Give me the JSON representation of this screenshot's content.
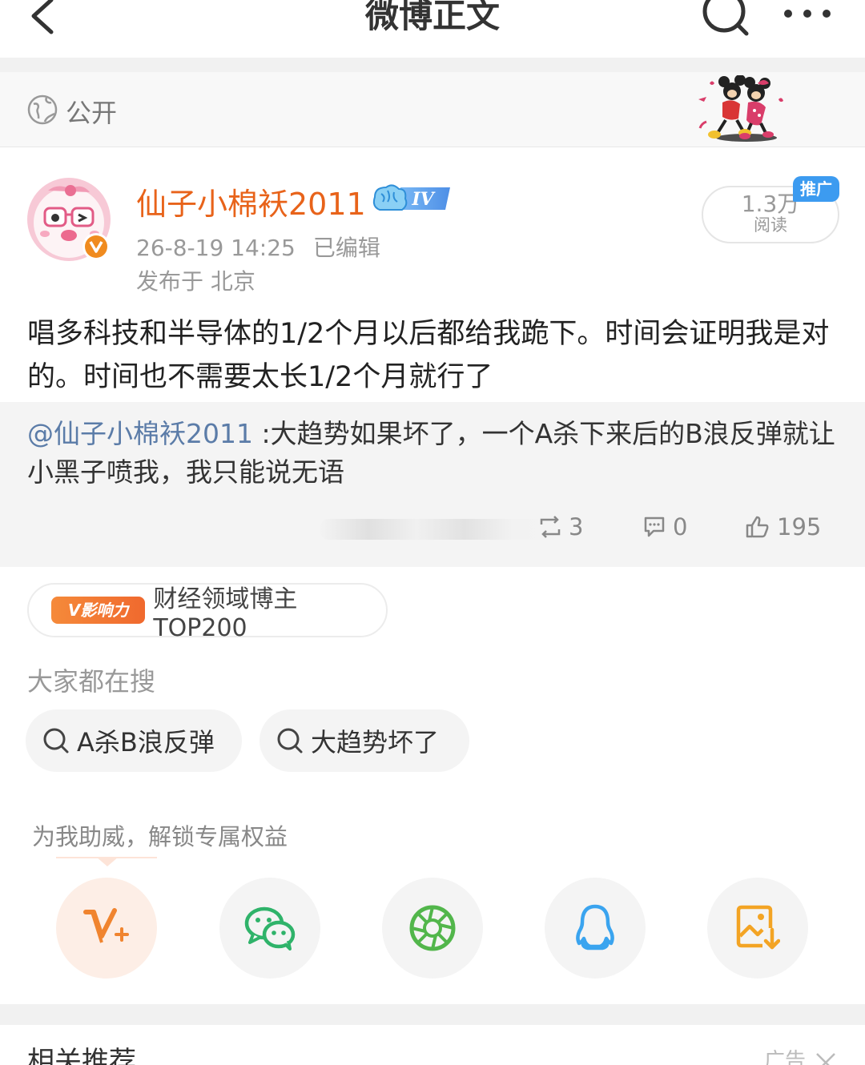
{
  "header": {
    "title": "微博正文"
  },
  "visibility": {
    "label": "公开"
  },
  "post": {
    "username": "仙子小棉袄2011",
    "level_badge": "IV",
    "time": "26-8-19 14:25",
    "edited": "已编辑",
    "location": "发布于 北京",
    "reads": "1.3万",
    "reads_label": "阅读",
    "promo": "推广",
    "text": "唱多科技和半导体的1/2个月以后都给我跪下。时间会证明我是对的。时间也不需要太长1/2个月就行了"
  },
  "retweet": {
    "user": "@仙子小棉袄2011",
    "text": " :大趋势如果坏了，一个A杀下来后的B浪反弹就让小黑子喷我，我只能说无语",
    "reposts": "3",
    "comments": "0",
    "likes": "195"
  },
  "influence": {
    "badge": "V影响力",
    "text": "财经领域博主TOP200"
  },
  "search": {
    "title": "大家都在搜",
    "chips": [
      "A杀B浪反弹",
      "大趋势坏了"
    ]
  },
  "support": {
    "title": "为我助威，解锁专属权益"
  },
  "related": {
    "title": "相关推荐",
    "ad": "广告"
  },
  "colors": {
    "username": "#e8631a",
    "link": "#5b7ca8",
    "promo": "#3c9bf0",
    "accent": "#f58a3a"
  },
  "icons": [
    "back-icon",
    "search-icon",
    "more-icon",
    "globe-icon",
    "repost-icon",
    "comment-icon",
    "like-icon",
    "v-plus-icon",
    "wechat-icon",
    "moments-icon",
    "qq-icon",
    "save-image-icon",
    "close-icon"
  ]
}
